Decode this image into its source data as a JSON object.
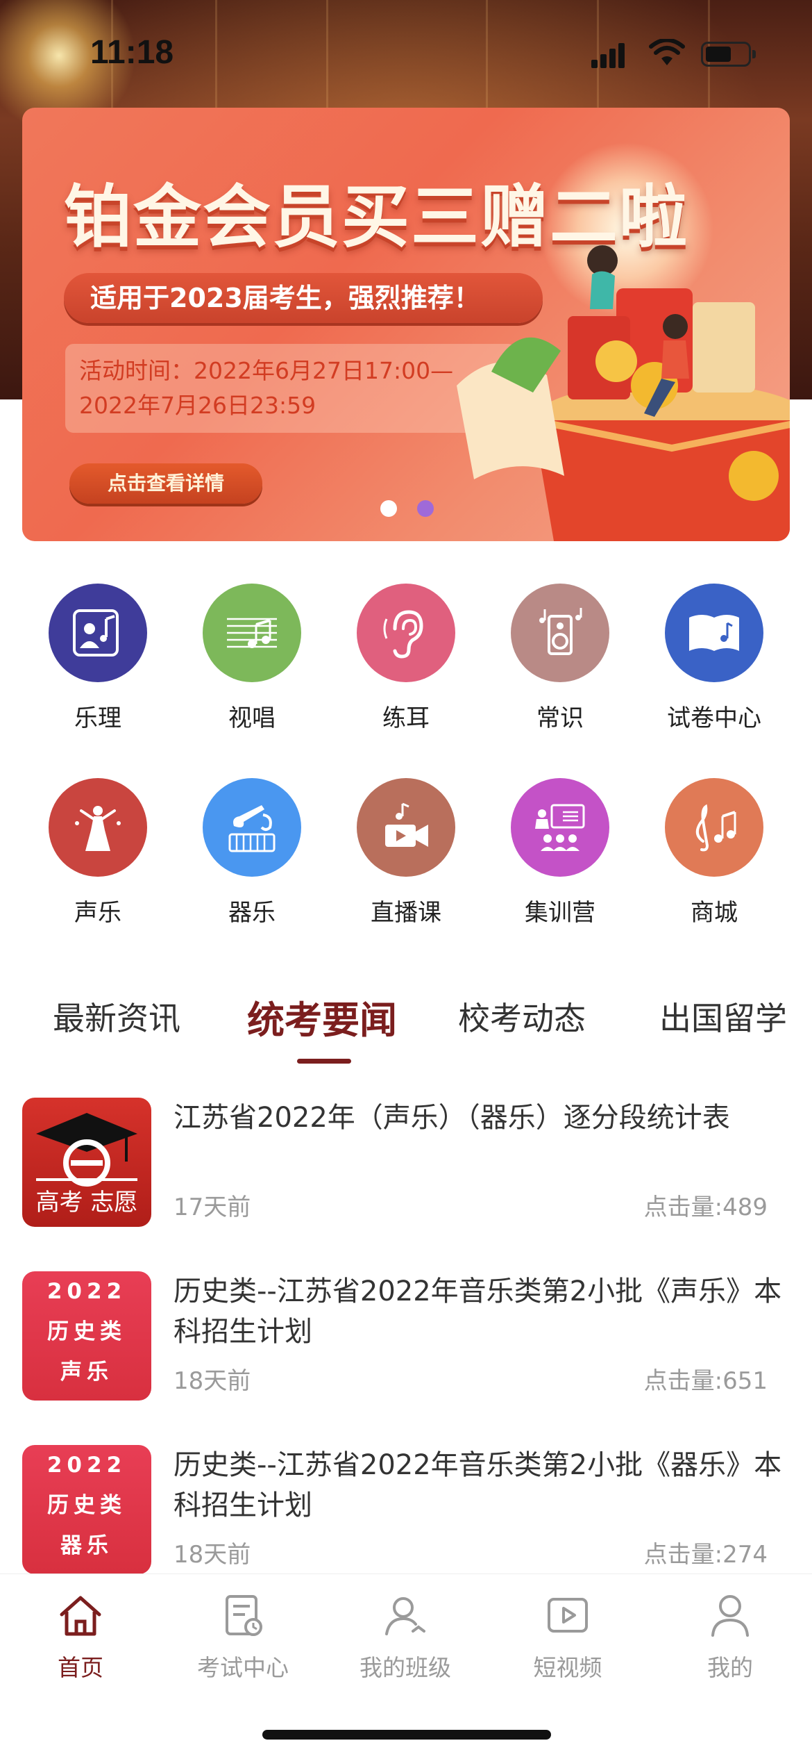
{
  "status_bar": {
    "time": "11:18"
  },
  "banner": {
    "title": "铂金会员买三赠二啦",
    "subtitle": "适用于2023届考生，强烈推荐！",
    "time_line1": "活动时间：2022年6月27日17:00—",
    "time_line2": "2022年7月26日23:59",
    "cta": "点击查看详情",
    "active_dot": 2,
    "dot_count": 2
  },
  "categories": [
    {
      "label": "乐理",
      "icon": "music-theory-icon",
      "color": "#3f3c9a"
    },
    {
      "label": "视唱",
      "icon": "sight-singing-icon",
      "color": "#7db85a"
    },
    {
      "label": "练耳",
      "icon": "ear-training-icon",
      "color": "#e0607e"
    },
    {
      "label": "常识",
      "icon": "music-knowledge-icon",
      "color": "#b98a86"
    },
    {
      "label": "试卷中心",
      "icon": "exam-papers-icon",
      "color": "#3a62c6"
    },
    {
      "label": "声乐",
      "icon": "vocal-icon",
      "color": "#c9453f"
    },
    {
      "label": "器乐",
      "icon": "instrument-icon",
      "color": "#4a97f0"
    },
    {
      "label": "直播课",
      "icon": "live-class-icon",
      "color": "#b96f5c"
    },
    {
      "label": "集训营",
      "icon": "training-camp-icon",
      "color": "#c452c7"
    },
    {
      "label": "商城",
      "icon": "shop-icon",
      "color": "#e07a56"
    }
  ],
  "tabs": [
    {
      "label": "最新资讯",
      "active": false
    },
    {
      "label": "统考要闻",
      "active": true
    },
    {
      "label": "校考动态",
      "active": false
    },
    {
      "label": "出国留学",
      "active": false
    }
  ],
  "news": [
    {
      "title": "江苏省2022年（声乐）（器乐）逐分段统计表",
      "date": "17天前",
      "views": "点击量:489",
      "thumb_type": "logo",
      "thumb_lines": [
        "高考",
        "志愿"
      ]
    },
    {
      "title": "历史类--江苏省2022年音乐类第2小批《声乐》本科招生计划",
      "date": "18天前",
      "views": "点击量:651",
      "thumb_type": "red",
      "thumb_lines": [
        "2022",
        "历史类",
        "声乐"
      ]
    },
    {
      "title": "历史类--江苏省2022年音乐类第2小批《器乐》本科招生计划",
      "date": "18天前",
      "views": "点击量:274",
      "thumb_type": "red",
      "thumb_lines": [
        "2022",
        "历史类",
        "器乐"
      ]
    }
  ],
  "bottom_nav": [
    {
      "label": "首页",
      "icon": "home-icon",
      "active": true
    },
    {
      "label": "考试中心",
      "icon": "exam-center-icon",
      "active": false
    },
    {
      "label": "我的班级",
      "icon": "my-class-icon",
      "active": false
    },
    {
      "label": "短视频",
      "icon": "short-video-icon",
      "active": false
    },
    {
      "label": "我的",
      "icon": "profile-icon",
      "active": false
    }
  ],
  "colors": {
    "accent": "#7b1e1e",
    "muted": "#9a9a9a",
    "banner": "#ef6a4f"
  }
}
